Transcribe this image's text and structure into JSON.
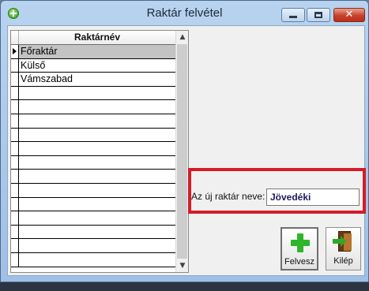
{
  "window": {
    "title": "Raktár felvétel",
    "close_glyph": "✕"
  },
  "grid": {
    "column_header": "Raktárnév",
    "rows": [
      "Főraktár",
      "Külső",
      "Vámszabad",
      "",
      "",
      "",
      "",
      "",
      "",
      "",
      "",
      "",
      "",
      "",
      "",
      ""
    ],
    "selected_index": 0,
    "scroll_up": "▲",
    "scroll_down": "▼"
  },
  "new_warehouse": {
    "label": "Az új raktár neve:",
    "value": "Jövedéki"
  },
  "buttons": {
    "add_label": "Felvesz",
    "exit_label": "Kilép"
  },
  "colors": {
    "highlight_border": "#d41c27",
    "add_icon": "#2fb52a",
    "selected_row": "#c3c3c3"
  },
  "icons": {
    "app": "add-icon",
    "add": "plus-icon",
    "exit": "exit-door-icon"
  }
}
